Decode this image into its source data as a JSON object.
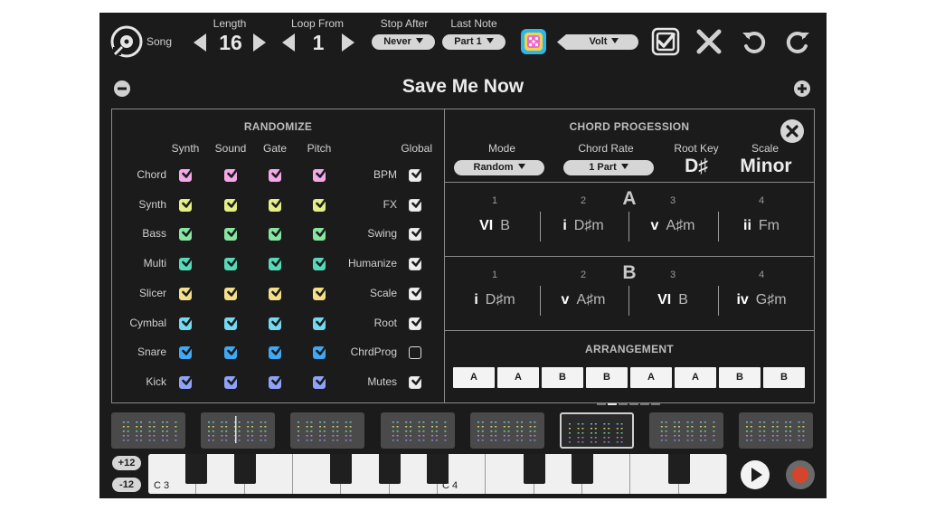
{
  "top": {
    "song_label": "Song",
    "length_label": "Length",
    "length_value": "16",
    "loop_from_label": "Loop From",
    "loop_from_value": "1",
    "stop_after_label": "Stop After",
    "stop_after_value": "Never",
    "last_note_label": "Last Note",
    "last_note_value": "Part 1",
    "preset_value": "Volt"
  },
  "title": "Save Me Now",
  "randomize": {
    "header": "RANDOMIZE",
    "columns": [
      "Synth",
      "Sound",
      "Gate",
      "Pitch"
    ],
    "global_header": "Global",
    "rows": [
      {
        "label": "Chord",
        "color": "#f3a8e8",
        "checks": [
          true,
          true,
          true,
          true
        ]
      },
      {
        "label": "Synth",
        "color": "#e3ef86",
        "checks": [
          true,
          true,
          true,
          true
        ]
      },
      {
        "label": "Bass",
        "color": "#86e6a0",
        "checks": [
          true,
          true,
          true,
          true
        ]
      },
      {
        "label": "Multi",
        "color": "#55d9b9",
        "checks": [
          true,
          true,
          true,
          true
        ]
      },
      {
        "label": "Slicer",
        "color": "#f3de8a",
        "checks": [
          true,
          true,
          true,
          true
        ]
      },
      {
        "label": "Cymbal",
        "color": "#74d8ef",
        "checks": [
          true,
          true,
          true,
          true
        ]
      },
      {
        "label": "Snare",
        "color": "#3fa9f5",
        "checks": [
          true,
          true,
          true,
          true
        ]
      },
      {
        "label": "Kick",
        "color": "#8ea2f7",
        "checks": [
          true,
          true,
          true,
          true
        ]
      }
    ],
    "global_rows": [
      {
        "label": "BPM",
        "checked": true
      },
      {
        "label": "FX",
        "checked": true
      },
      {
        "label": "Swing",
        "checked": true
      },
      {
        "label": "Humanize",
        "checked": true
      },
      {
        "label": "Scale",
        "checked": true
      },
      {
        "label": "Root",
        "checked": true
      },
      {
        "label": "ChrdProg",
        "checked": false
      },
      {
        "label": "Mutes",
        "checked": true
      }
    ]
  },
  "chords": {
    "header": "CHORD PROGESSION",
    "mode_label": "Mode",
    "mode_value": "Random",
    "rate_label": "Chord Rate",
    "rate_value": "1 Part",
    "root_label": "Root Key",
    "root_value": "D♯",
    "scale_label": "Scale",
    "scale_value": "Minor",
    "parts": [
      {
        "name": "A",
        "chords": [
          {
            "num": "1",
            "deg": "VI",
            "name": "B"
          },
          {
            "num": "2",
            "deg": "i",
            "name": "D♯m"
          },
          {
            "num": "3",
            "deg": "v",
            "name": "A♯m"
          },
          {
            "num": "4",
            "deg": "ii",
            "name": "Fm"
          }
        ]
      },
      {
        "name": "B",
        "chords": [
          {
            "num": "1",
            "deg": "i",
            "name": "D♯m"
          },
          {
            "num": "2",
            "deg": "v",
            "name": "A♯m"
          },
          {
            "num": "3",
            "deg": "VI",
            "name": "B"
          },
          {
            "num": "4",
            "deg": "iv",
            "name": "G♯m"
          }
        ]
      }
    ],
    "arrangement_header": "ARRANGEMENT",
    "arrangement": [
      "A",
      "A",
      "B",
      "B",
      "A",
      "A",
      "B",
      "B"
    ]
  },
  "keyboard": {
    "octave_up": "+12",
    "octave_down": "-12",
    "c3_label": "C 3",
    "c4_label": "C 4"
  },
  "colors": {
    "background": "#1b1b1b",
    "record": "#d6452b",
    "dice": "#2fb6e8"
  }
}
